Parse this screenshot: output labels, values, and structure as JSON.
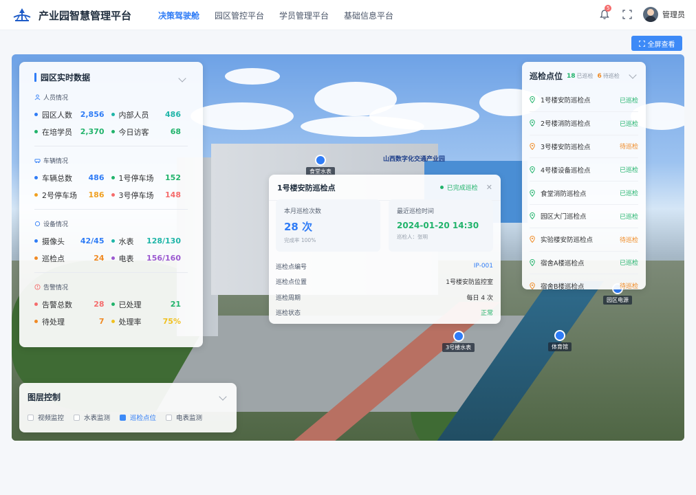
{
  "header": {
    "app_title": "产业园智慧管理平台",
    "nav": [
      "决策驾驶舱",
      "园区管控平台",
      "学员管理平台",
      "基础信息平台"
    ],
    "active_nav": 0,
    "notification_count": "5",
    "username": "管理员"
  },
  "fullscreen_label": "全屏查看",
  "stats_panel": {
    "title": "园区实时数据",
    "sections": [
      {
        "title": "人员情况",
        "rows": [
          [
            {
              "label": "园区人数",
              "value": "2,856",
              "color": "#2f7cf6"
            },
            {
              "label": "内部人员",
              "value": "486",
              "color": "#1fb5a8"
            }
          ],
          [
            {
              "label": "在培学员",
              "value": "2,370",
              "color": "#21b36b"
            },
            {
              "label": "今日访客",
              "value": "68",
              "color": "#21b36b"
            }
          ]
        ]
      },
      {
        "title": "车辆情况",
        "rows": [
          [
            {
              "label": "车辆总数",
              "value": "486",
              "color": "#2f7cf6"
            },
            {
              "label": "1号停车场",
              "value": "152",
              "color": "#21b36b"
            }
          ],
          [
            {
              "label": "2号停车场",
              "value": "186",
              "color": "#f0a020"
            },
            {
              "label": "3号停车场",
              "value": "148",
              "color": "#f56c6c"
            }
          ]
        ]
      },
      {
        "title": "设备情况",
        "rows": [
          [
            {
              "label": "摄像头",
              "value": "42/45",
              "color": "#2f7cf6"
            },
            {
              "label": "水表",
              "value": "128/130",
              "color": "#1fb5a8"
            }
          ],
          [
            {
              "label": "巡检点",
              "value": "24",
              "color": "#f08a24"
            },
            {
              "label": "电表",
              "value": "156/160",
              "color": "#9b59d0"
            }
          ]
        ]
      },
      {
        "title": "告警情况",
        "rows": [
          [
            {
              "label": "告警总数",
              "value": "28",
              "color": "#f56c6c"
            },
            {
              "label": "已处理",
              "value": "21",
              "color": "#21b36b"
            }
          ],
          [
            {
              "label": "待处理",
              "value": "7",
              "color": "#f08a24"
            },
            {
              "label": "处理率",
              "value": "75%",
              "color": "#f0c020"
            }
          ]
        ]
      }
    ]
  },
  "layers_panel": {
    "title": "图层控制",
    "options": [
      {
        "label": "视频监控",
        "checked": false
      },
      {
        "label": "水表监测",
        "checked": false
      },
      {
        "label": "巡检点位",
        "checked": true
      },
      {
        "label": "电表监测",
        "checked": false
      }
    ]
  },
  "patrol_panel": {
    "title": "巡检点位",
    "done_count": "18",
    "done_label": "已巡检",
    "pending_count": "6",
    "pending_label": "待巡检",
    "items": [
      {
        "name": "1号楼安防巡检点",
        "status": "已巡检",
        "done": true
      },
      {
        "name": "2号楼消防巡检点",
        "status": "已巡检",
        "done": true
      },
      {
        "name": "3号楼安防巡检点",
        "status": "待巡检",
        "done": false
      },
      {
        "name": "4号楼设备巡检点",
        "status": "已巡检",
        "done": true
      },
      {
        "name": "食堂消防巡检点",
        "status": "已巡检",
        "done": true
      },
      {
        "name": "园区大门巡检点",
        "status": "已巡检",
        "done": true
      },
      {
        "name": "实验楼安防巡检点",
        "status": "待巡检",
        "done": false
      },
      {
        "name": "宿舍A楼巡检点",
        "status": "已巡检",
        "done": true
      },
      {
        "name": "宿舍B楼巡检点",
        "status": "待巡检",
        "done": false
      }
    ]
  },
  "popup": {
    "title": "1号楼安防巡检点",
    "status": "已完成巡检",
    "card1": {
      "label": "本月巡检次数",
      "value": "28 次",
      "sub": "完成率 100%"
    },
    "card2": {
      "label": "最近巡检时间",
      "value": "2024-01-20 14:30",
      "sub": "巡检人：张明"
    },
    "info": [
      {
        "key": "巡检点编号",
        "value": "IP-001",
        "accent": "#2f7cf6"
      },
      {
        "key": "巡检点位置",
        "value": "1号楼安防监控室",
        "accent": "#303133"
      },
      {
        "key": "巡检周期",
        "value": "每日 4 次",
        "accent": "#303133"
      },
      {
        "key": "巡检状态",
        "value": "正常",
        "accent": "#21b36b"
      }
    ]
  },
  "map_markers": [
    {
      "label": "食堂水表"
    },
    {
      "label": "3号楼水表"
    },
    {
      "label": "体育馆"
    },
    {
      "label": "园区电源"
    }
  ],
  "building_signs": [
    "山西数字化交通产业园"
  ]
}
